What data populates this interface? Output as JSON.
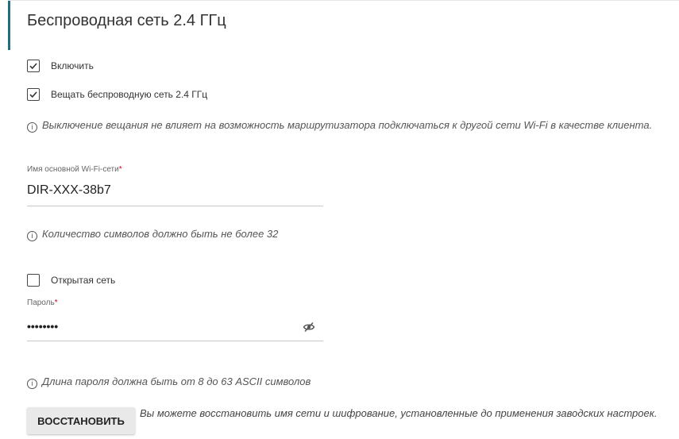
{
  "section": {
    "title": "Беспроводная сеть 2.4 ГГц"
  },
  "enable": {
    "label": "Включить",
    "checked": true
  },
  "broadcast": {
    "label": "Вещать беспроводную сеть 2.4 ГГц",
    "checked": true
  },
  "broadcast_info": "Выключение вещания не влияет на возможность маршрутизатора подключаться к другой сети Wi-Fi в качестве клиента.",
  "ssid": {
    "label": "Имя основной Wi-Fi-сети",
    "required_mark": "*",
    "value": "DIR-XXX-38b7",
    "hint": "Количество символов должно быть не более 32"
  },
  "open_network": {
    "label": "Открытая сеть",
    "checked": false
  },
  "password": {
    "label": "Пароль",
    "required_mark": "*",
    "masked_value": "••••••••",
    "hint": "Длина пароля должна быть от 8 до 63 ASCII символов"
  },
  "restore": {
    "button_label": "ВОССТАНОВИТЬ",
    "description": "Вы можете восстановить имя сети и шифрование, установленные до применения заводских настроек."
  },
  "colors": {
    "accent": "#1f6f7a",
    "required": "#d0021b"
  }
}
